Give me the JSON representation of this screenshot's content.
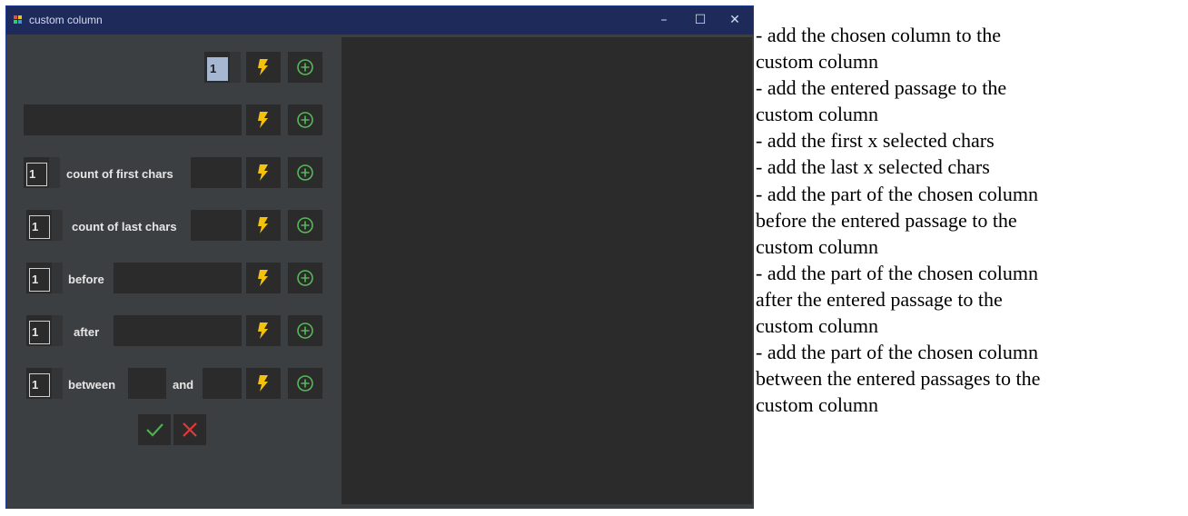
{
  "window": {
    "title": "custom column",
    "buttons": {
      "minimize": "–",
      "maximize": "☐",
      "close": "✕"
    }
  },
  "rows": [
    {
      "spinner_value": "1",
      "label": ""
    },
    {
      "label": ""
    },
    {
      "spinner_value": "1",
      "label": "count of first chars"
    },
    {
      "spinner_value": "1",
      "label": "count of last chars"
    },
    {
      "spinner_value": "1",
      "label": "before"
    },
    {
      "spinner_value": "1",
      "label": "after"
    },
    {
      "spinner_value": "1",
      "label": "between",
      "label2": "and"
    }
  ],
  "actions": {
    "confirm_icon": "check-icon",
    "cancel_icon": "x-icon"
  },
  "icons": {
    "run": "lightning-icon",
    "add": "plus-circle-icon"
  },
  "colors": {
    "lightning": "#f4c20d",
    "plus": "#57b85a",
    "check": "#4caf50",
    "cancel": "#e53935",
    "titlebar": "#1e2a5a"
  },
  "description_lines": [
    "- add the chosen column  to the",
    "custom column",
    "- add the entered passage to the",
    "custom column",
    "- add the first x selected chars",
    "- add the last x selected chars",
    "- add the part of the chosen column",
    "before the entered  passage to the",
    "custom column",
    "- add the part of the chosen column",
    "after the entered  passage to the",
    "custom column",
    "- add the part of the chosen column",
    "between the entered  passages to the",
    "custom column"
  ]
}
